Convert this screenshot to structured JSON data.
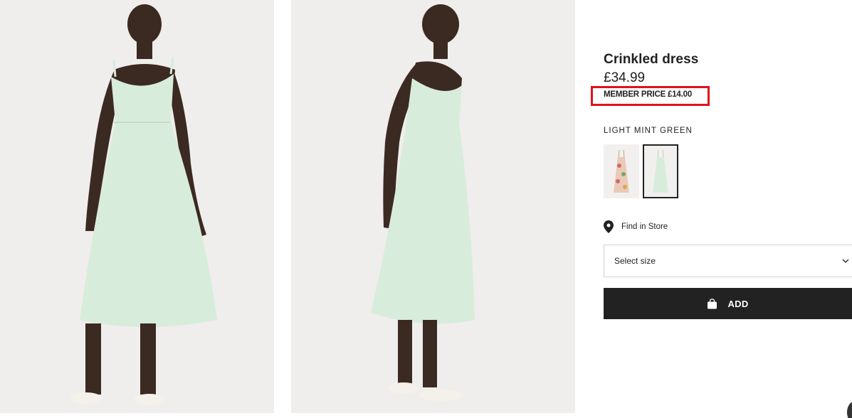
{
  "product": {
    "title": "Crinkled dress",
    "price": "£34.99",
    "member_price": "MEMBER PRICE £14.00",
    "highlight_color": "#e0121b"
  },
  "colors": {
    "selected_name": "LIGHT MINT GREEN",
    "swatches": [
      {
        "name": "floral-print-swatch",
        "selected": false
      },
      {
        "name": "light-mint-green-swatch",
        "selected": true
      }
    ],
    "dress_color": "#d8ecdb"
  },
  "store": {
    "find_label": "Find in Store",
    "icon": "location-pin-icon"
  },
  "size": {
    "placeholder": "Select size",
    "icon": "chevron-down-icon"
  },
  "cart": {
    "add_label": "ADD",
    "icon": "shopping-bag-icon",
    "button_color": "#222222"
  }
}
